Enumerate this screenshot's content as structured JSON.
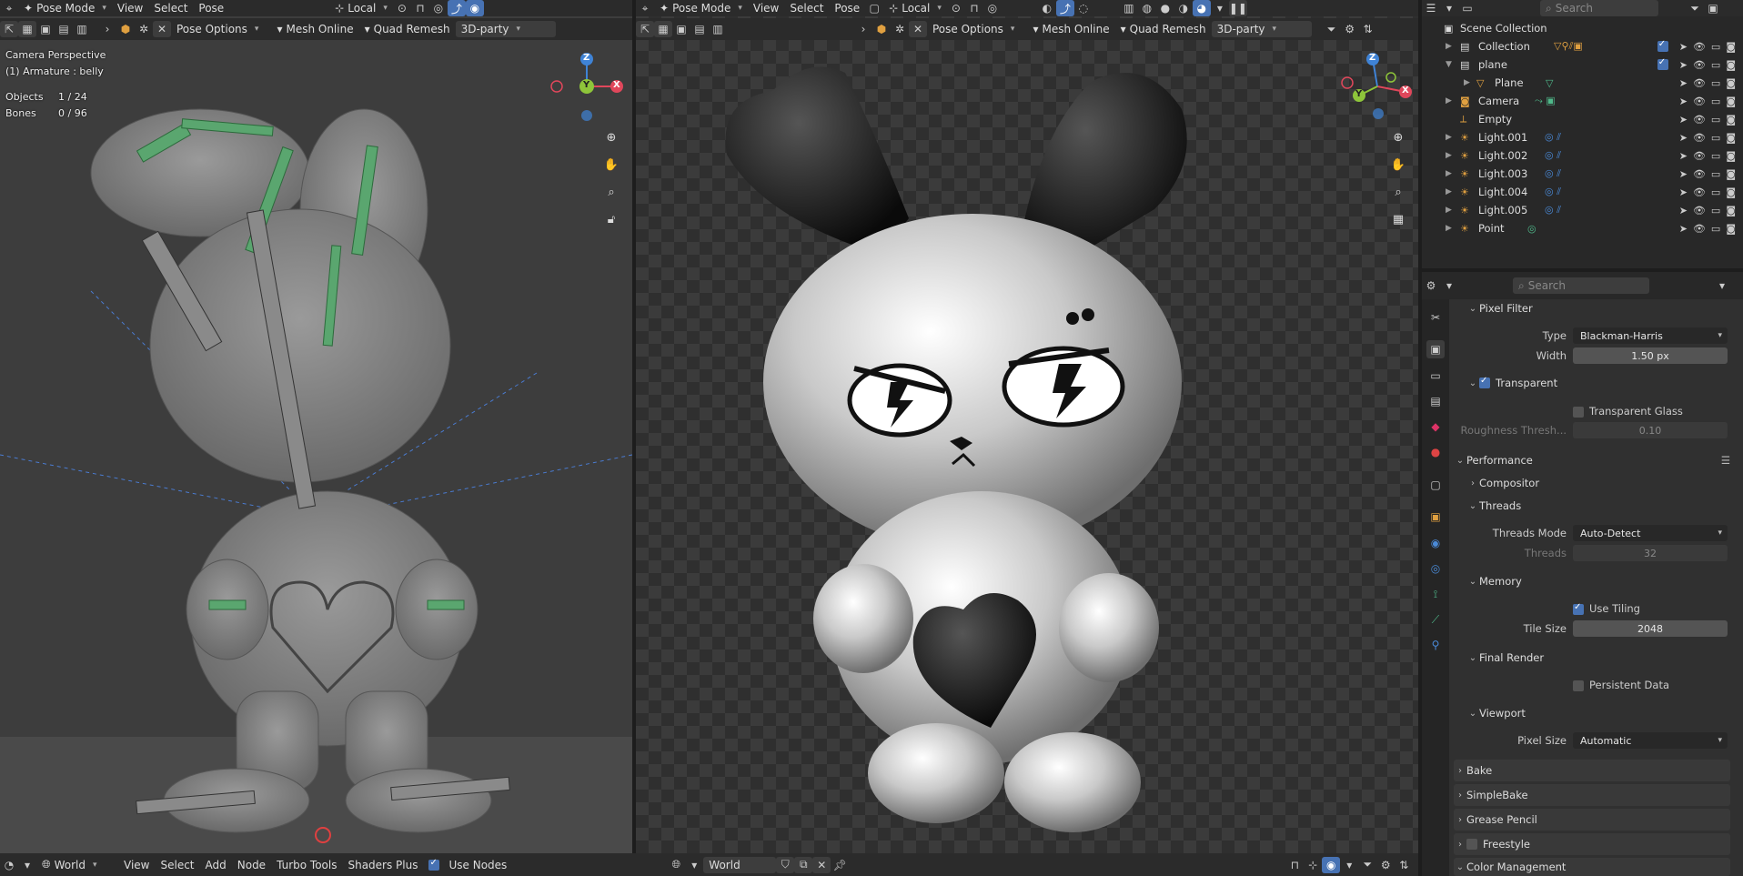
{
  "colors": {
    "accent": "#4772b3",
    "bone_green": "#4fa86a",
    "x_axis": "#e0475b",
    "y_axis": "#8ec53a",
    "z_axis": "#3f83d6",
    "header": "#2b2b2b",
    "panel": "#303030"
  },
  "left_header": {
    "row1": {
      "mode": "Pose Mode",
      "menus": [
        "View",
        "Select",
        "Pose"
      ],
      "transform": "Local"
    },
    "row2": {
      "pose_options": "Pose Options",
      "mesh_online": "Mesh Online",
      "quad_remesh": "Quad Remesh",
      "third_party": "3D-party"
    }
  },
  "right_header": {
    "row1": {
      "mode": "Pose Mode",
      "menus": [
        "View",
        "Select",
        "Pose"
      ],
      "transform": "Local"
    },
    "row2": {
      "pose_options": "Pose Options",
      "mesh_online": "Mesh Online",
      "quad_remesh": "Quad Remesh",
      "third_party": "3D-party"
    }
  },
  "left_viewport": {
    "perspective": "Camera Perspective",
    "active": "(1) Armature : belly",
    "stats": [
      {
        "label": "Objects",
        "value": "1 / 24"
      },
      {
        "label": "Bones",
        "value": "0 / 96"
      }
    ],
    "gizmo": {
      "x": "X",
      "y": "Y",
      "z": "Z"
    }
  },
  "right_viewport": {
    "gizmo": {
      "x": "X",
      "y": "Y",
      "z": "Z"
    }
  },
  "outliner": {
    "search_placeholder": "Search",
    "root": "Scene Collection",
    "items": [
      {
        "name": "Collection",
        "icon": "collection-icon"
      },
      {
        "name": "plane",
        "icon": "collection-icon"
      },
      {
        "name": "Plane",
        "icon": "mesh-icon"
      },
      {
        "name": "Camera",
        "icon": "camera-icon"
      },
      {
        "name": "Empty",
        "icon": "empty-icon"
      },
      {
        "name": "Light.001",
        "icon": "light-icon"
      },
      {
        "name": "Light.002",
        "icon": "light-icon"
      },
      {
        "name": "Light.003",
        "icon": "light-icon"
      },
      {
        "name": "Light.004",
        "icon": "light-icon"
      },
      {
        "name": "Light.005",
        "icon": "light-icon"
      },
      {
        "name": "Point",
        "icon": "light-icon"
      }
    ]
  },
  "properties": {
    "search_placeholder": "Search",
    "pixel_filter": {
      "title": "Pixel Filter",
      "type_label": "Type",
      "type_value": "Blackman-Harris",
      "width_label": "Width",
      "width_value": "1.50 px"
    },
    "transparent": {
      "title": "Transparent",
      "glass": "Transparent Glass",
      "rough_label": "Roughness Thresh...",
      "rough_value": "0.10"
    },
    "performance": {
      "title": "Performance",
      "compositor": "Compositor",
      "threads": "Threads",
      "threads_mode_label": "Threads Mode",
      "threads_mode_value": "Auto-Detect",
      "threads_label": "Threads",
      "threads_value": "32"
    },
    "memory": {
      "title": "Memory",
      "use_tiling": "Use Tiling",
      "tile_label": "Tile Size",
      "tile_value": "2048"
    },
    "final_render": {
      "title": "Final Render",
      "persistent": "Persistent Data"
    },
    "viewport": {
      "title": "Viewport",
      "pixel_label": "Pixel Size",
      "pixel_value": "Automatic"
    },
    "collapsed": [
      "Bake",
      "SimpleBake",
      "Grease Pencil",
      "Freestyle",
      "Color Management"
    ]
  },
  "bottom_bar": {
    "world": "World",
    "menus": [
      "View",
      "Select",
      "Add",
      "Node",
      "Turbo Tools",
      "Shaders Plus"
    ],
    "use_nodes": "Use Nodes",
    "world2": "World"
  }
}
